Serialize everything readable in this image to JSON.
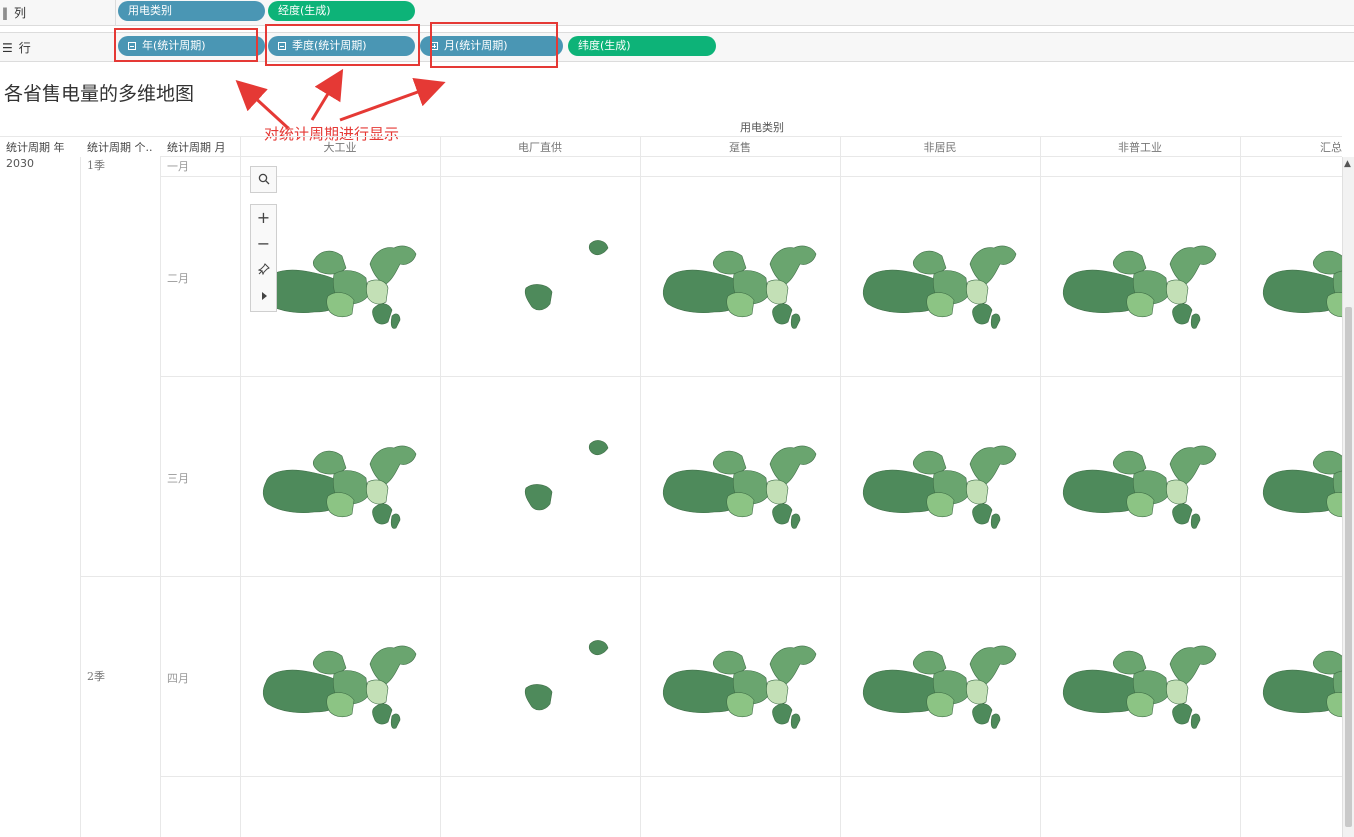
{
  "shelves": {
    "columns": {
      "label": "列",
      "icon": "columns-icon",
      "pills": [
        {
          "text": "用电类别",
          "color": "#4a96b4"
        },
        {
          "text": "经度(生成)",
          "color": "#0db378"
        }
      ]
    },
    "rows": {
      "label": "行",
      "icon": "rows-icon",
      "pills": [
        {
          "text": "年(统计周期)",
          "color": "#4a96b4"
        },
        {
          "text": "季度(统计周期)",
          "color": "#4a96b4"
        },
        {
          "text": "月(统计周期)",
          "color": "#4a96b4"
        },
        {
          "text": "纬度(生成)",
          "color": "#0db378"
        }
      ]
    }
  },
  "sheet": {
    "title": "各省售电量的多维地图"
  },
  "annotation": {
    "text": "对统计周期进行显示",
    "color": "#e53935"
  },
  "table": {
    "column_group_header": "用电类别",
    "row_headers": [
      "统计周期 年",
      "统计周期 个..",
      "统计周期 月"
    ],
    "columns": [
      "大工业",
      "电厂直供",
      "趸售",
      "非居民",
      "非普工业",
      "汇总"
    ],
    "year": "2030",
    "quarters": [
      "1季",
      "2季"
    ],
    "months": [
      "一月",
      "二月",
      "三月",
      "四月"
    ]
  },
  "map_colors": {
    "dark": "#4e8a5b",
    "mid": "#6aa56f",
    "light": "#8cc484",
    "pale": "#c3e0b6",
    "pink": "#f3b8a8",
    "beige": "#e0d8c8"
  },
  "map_tools": [
    "search-icon",
    "zoom-in-icon",
    "zoom-out-icon",
    "pin-icon",
    "expand-arrow-icon"
  ]
}
